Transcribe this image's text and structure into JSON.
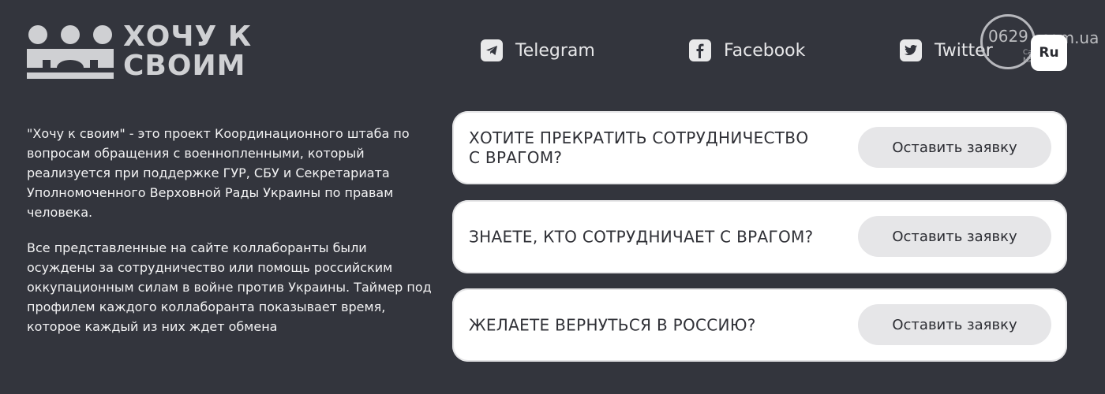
{
  "header": {
    "logo": {
      "line1": "ХОЧУ К",
      "line2": "СВОИМ"
    },
    "social": [
      {
        "label": "Telegram",
        "icon": "telegram-icon"
      },
      {
        "label": "Facebook",
        "icon": "facebook-icon"
      },
      {
        "label": "Twitter",
        "icon": "twitter-icon"
      }
    ],
    "watermark": {
      "number": "0629",
      "domain": ".com.ua",
      "small_line1": "Сайт",
      "small_line2": "Ма"
    },
    "language": "Ru"
  },
  "description": {
    "paragraphs": [
      "\"Хочу к своим\" - это проект Координационного штаба по вопросам обращения с военнопленными, который реализуется при поддержке ГУР, СБУ и Секретариата Уполномоченного Верховной Рады Украины по правам человека.",
      "Все представленные на сайте коллаборанты были осуждены за сотрудничество или помощь российским оккупационным силам в войне против Украины. Таймер под профилем каждого коллаборанта показывает время, которое каждый из них ждет обмена"
    ]
  },
  "cards": [
    {
      "question": "ХОТИТЕ ПРЕКРАТИТЬ СОТРУДНИЧЕСТВО С ВРАГОМ?",
      "button": "Оставить заявку"
    },
    {
      "question": "ЗНАЕТЕ, КТО СОТРУДНИЧАЕТ С ВРАГОМ?",
      "button": "Оставить заявку"
    },
    {
      "question": "ЖЕЛАЕТЕ ВЕРНУТЬСЯ В РОССИЮ?",
      "button": "Оставить заявку"
    }
  ],
  "colors": {
    "background": "#33353d",
    "card": "#ffffff",
    "button": "#e6e6e8",
    "logo": "#cfd0d3"
  }
}
